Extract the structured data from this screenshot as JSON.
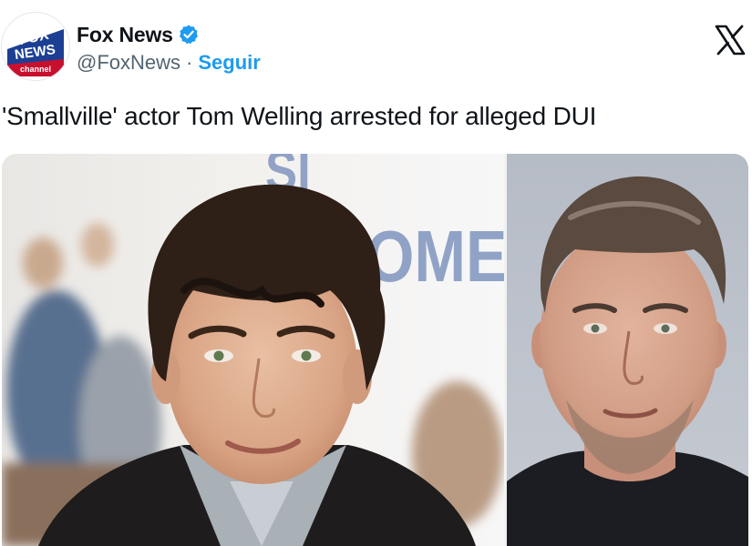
{
  "account": {
    "display_name": "Fox News",
    "handle": "@FoxNews",
    "separator": "·",
    "follow_label": "Seguir",
    "logo_top": "FOX",
    "logo_middle": "NEWS",
    "logo_bottom": "channel",
    "verified": true
  },
  "tweet": {
    "text": "'Smallville' actor Tom Welling arrested for alleged DUI"
  },
  "media": {
    "backdrop_letters": "SI",
    "backdrop_letters_2": "OMEI",
    "images": [
      "actor-portrait-young",
      "actor-mugshot"
    ]
  },
  "colors": {
    "verified_blue": "#1d9bf0",
    "link_blue": "#1d9bf0",
    "handle_gray": "#536471",
    "text_black": "#0f1419",
    "fox_blue": "#1c3f94",
    "fox_red": "#c8102e"
  },
  "icons": {
    "verified": "verified-badge-icon",
    "platform": "x-logo-icon"
  }
}
